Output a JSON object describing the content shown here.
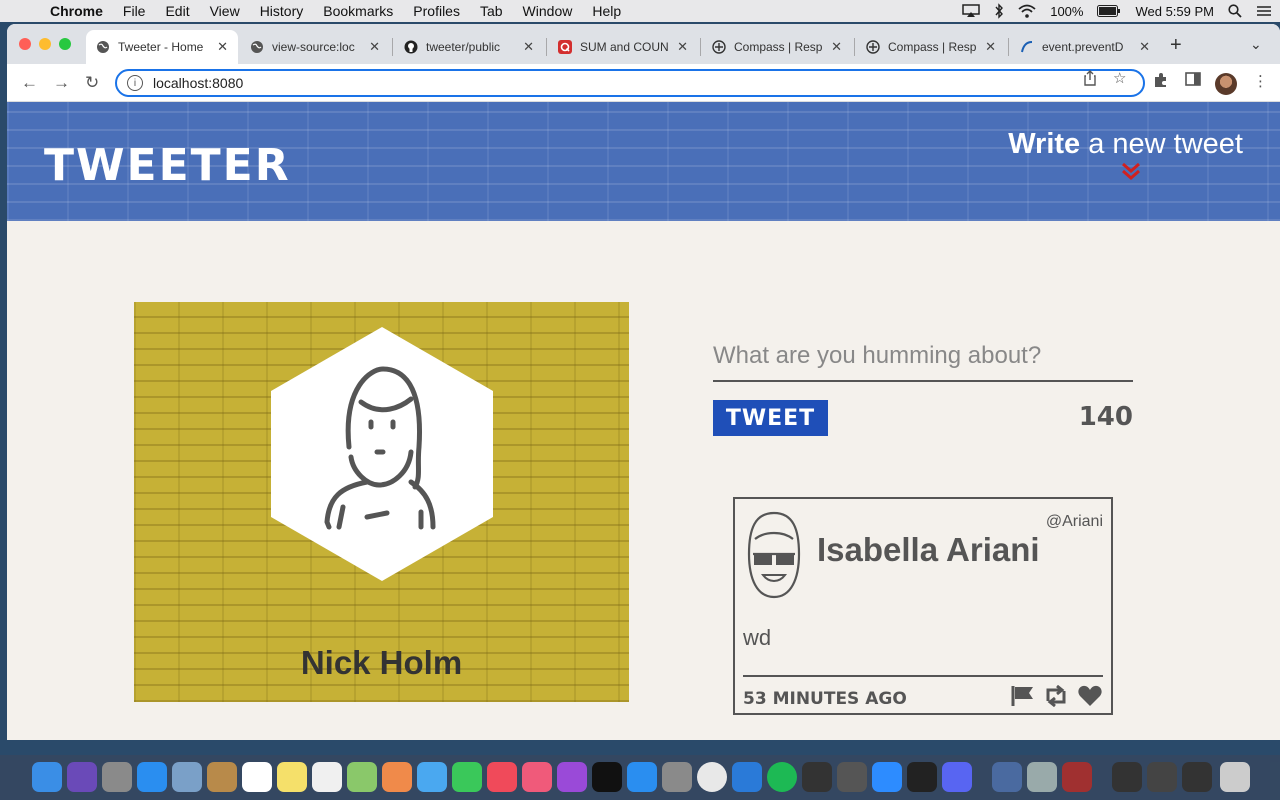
{
  "menubar": {
    "app": "Chrome",
    "items": [
      "File",
      "Edit",
      "View",
      "History",
      "Bookmarks",
      "Profiles",
      "Tab",
      "Window",
      "Help"
    ],
    "battery": "100%",
    "clock": "Wed 5:59 PM"
  },
  "tabs": [
    {
      "title": "Tweeter - Home",
      "icon": "globe-icon"
    },
    {
      "title": "view-source:loc",
      "icon": "globe-icon"
    },
    {
      "title": "tweeter/public",
      "icon": "github-icon"
    },
    {
      "title": "SUM and COUN",
      "icon": "q-icon"
    },
    {
      "title": "Compass | Resp",
      "icon": "compass-icon"
    },
    {
      "title": "Compass | Resp",
      "icon": "compass-icon"
    },
    {
      "title": "event.preventD",
      "icon": "mdn-icon"
    }
  ],
  "address_bar": {
    "url": "localhost:8080"
  },
  "page": {
    "brand": "tweeter",
    "write_bold": "Write",
    "write_rest": " a new tweet",
    "profile_name": "Nick Holm",
    "compose_placeholder": "What are you humming about?",
    "tweet_button": "Tweet",
    "counter": "140",
    "tweet": {
      "name": "Isabella Ariani",
      "handle": "@Ariani",
      "content": "wd",
      "time": "53 minutes ago"
    }
  },
  "colors": {
    "nav_blue": "#4a6fb8",
    "tweet_button": "#1f4fb8",
    "profile_yellow": "#c6b136",
    "chevron_red": "#d12020",
    "page_bg": "#f4f1ec"
  }
}
